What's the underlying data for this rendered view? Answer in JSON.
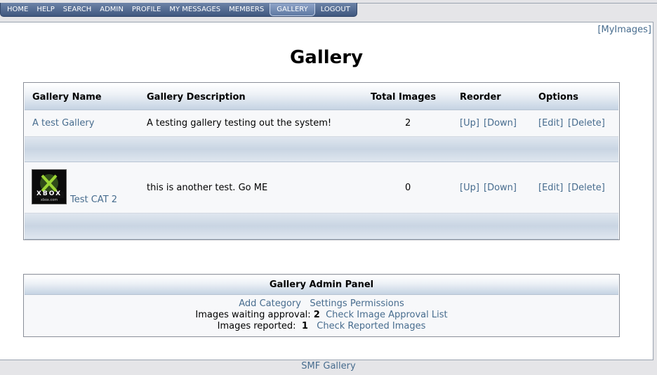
{
  "nav": {
    "home": "HOME",
    "help": "HELP",
    "search": "SEARCH",
    "admin": "ADMIN",
    "profile": "PROFILE",
    "messages": "MY MESSAGES",
    "members": "MEMBERS",
    "gallery": "GALLERY",
    "logout": "LOGOUT"
  },
  "my_images_link": "[MyImages]",
  "page_title": "Gallery",
  "table": {
    "headers": {
      "name": "Gallery Name",
      "description": "Gallery Description",
      "total": "Total Images",
      "reorder": "Reorder",
      "options": "Options"
    },
    "rows": [
      {
        "name": "A test Gallery",
        "description": "A testing gallery testing out the system!",
        "total": "2",
        "up": "[Up]",
        "down": "[Down]",
        "edit": "[Edit]",
        "delete": "[Delete]"
      },
      {
        "name": "Test CAT 2",
        "thumb_label": "XBOX",
        "thumb_sub": "xbox.com",
        "description": "this is another test. Go ME",
        "total": "0",
        "up": "[Up]",
        "down": "[Down]",
        "edit": "[Edit]",
        "delete": "[Delete]"
      }
    ]
  },
  "admin_panel": {
    "title": "Gallery Admin Panel",
    "add_category": "Add Category",
    "settings": "Settings",
    "permissions": "Permissions",
    "waiting_label": "Images waiting approval:",
    "waiting_count": "2",
    "approval_link": "Check Image Approval List",
    "reported_label": "Images reported:",
    "reported_count": "1",
    "reported_link": "Check Reported Images"
  },
  "footer_link": "SMF Gallery",
  "colors": {
    "nav_bg": "#4f6890",
    "link": "#476c8e",
    "header_gradient_end": "#c5d3e3"
  }
}
